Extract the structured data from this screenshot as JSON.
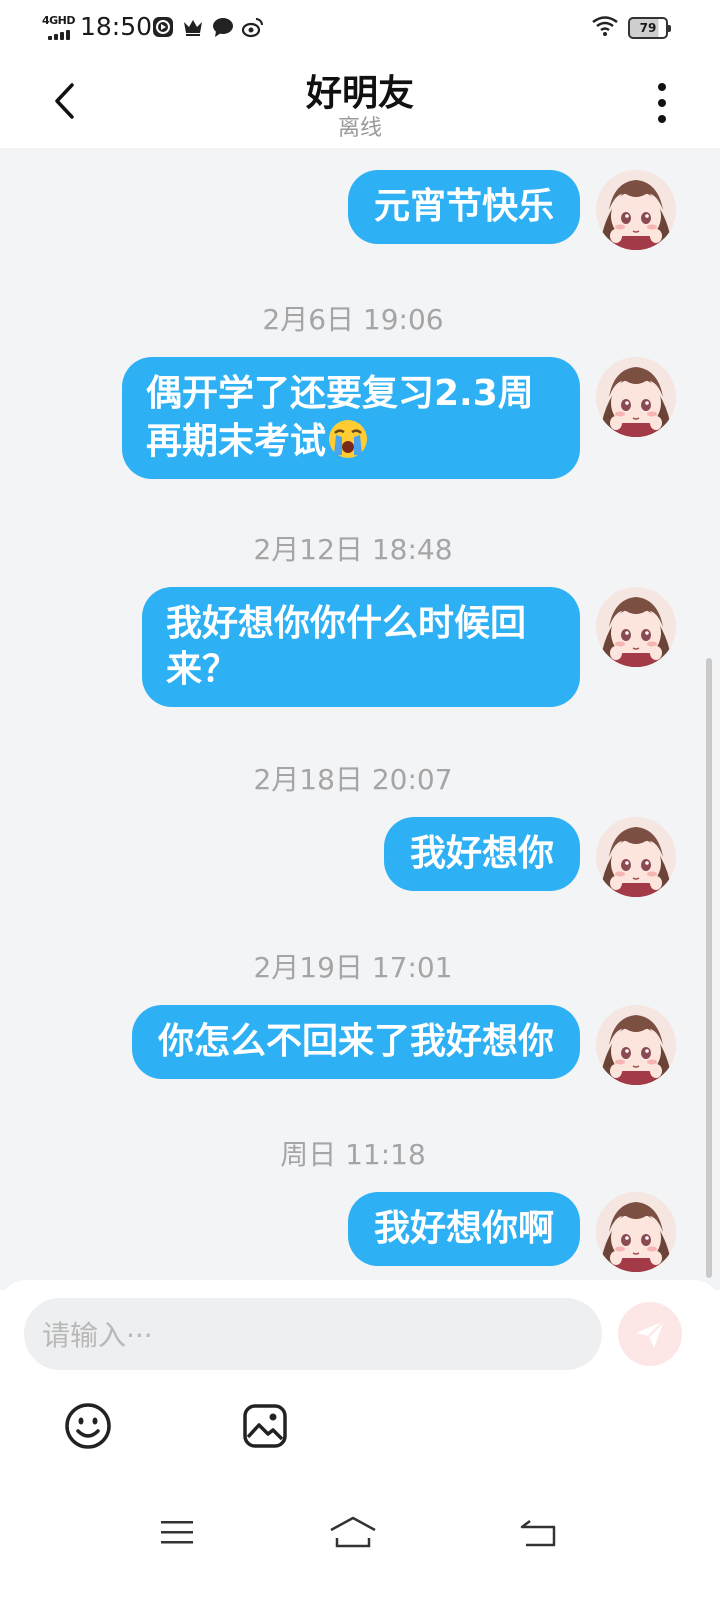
{
  "status_bar": {
    "network": "4GHD",
    "time": "18:50",
    "battery": "79",
    "icons": [
      "play-circle-icon",
      "crown-icon",
      "chat-bubble-icon",
      "weibo-icon",
      "wifi-icon",
      "battery-icon"
    ]
  },
  "header": {
    "title": "好明友",
    "status": "离线",
    "back_icon": "chevron-left-icon",
    "more_icon": "more-vertical-icon"
  },
  "messages": [
    {
      "timestamp": "",
      "text": "元宵节快乐",
      "emoji": ""
    },
    {
      "timestamp": "2月6日 19:06",
      "text_lines": [
        "偶开学了还要复习2.3周",
        "再期末考试"
      ],
      "emoji": "loudly-crying-face-emoji"
    },
    {
      "timestamp": "2月12日 18:48",
      "text_lines": [
        "我好想你你什么时候回",
        "来？"
      ],
      "emoji": ""
    },
    {
      "timestamp": "2月18日 20:07",
      "text": "我好想你",
      "emoji": ""
    },
    {
      "timestamp": "2月19日 17:01",
      "text": "你怎么不回来了我好想你",
      "emoji": ""
    },
    {
      "timestamp": "周日 11:18",
      "text": "我好想你啊",
      "emoji": ""
    }
  ],
  "composer": {
    "placeholder": "请输入···",
    "send_icon": "send-paper-plane-icon",
    "tools": [
      "smiley-icon",
      "image-icon"
    ]
  },
  "nav_bar": {
    "icons": [
      "menu-icon",
      "home-icon",
      "back-icon"
    ]
  },
  "colors": {
    "bubble": "#2eb0f5",
    "chat_background": "#f3f4f6",
    "send_button": "#fde6e6"
  }
}
